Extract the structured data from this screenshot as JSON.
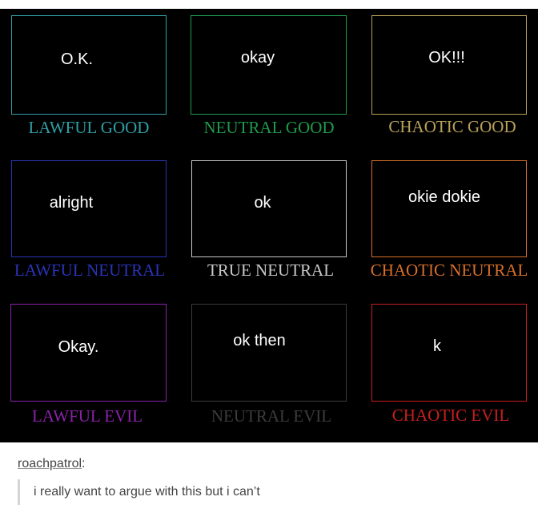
{
  "alignment_chart": {
    "cells": [
      {
        "word": "O.K.",
        "label": "LAWFUL GOOD",
        "color": "#2e9ea6"
      },
      {
        "word": "okay",
        "label": "NEUTRAL GOOD",
        "color": "#1f9a4a"
      },
      {
        "word": "OK!!!",
        "label": "CHAOTIC GOOD",
        "color": "#b9a159"
      },
      {
        "word": "alright",
        "label": "LAWFUL NEUTRAL",
        "color": "#2a34b8"
      },
      {
        "word": "ok",
        "label": "TRUE NEUTRAL",
        "color": "#c9c9c9"
      },
      {
        "word": "okie dokie",
        "label": "CHAOTIC NEUTRAL",
        "color": "#d9702b"
      },
      {
        "word": "Okay.",
        "label": "LAWFUL EVIL",
        "color": "#8a22a8"
      },
      {
        "word": "ok then",
        "label": "NEUTRAL EVIL",
        "color": "#3c3c3c"
      },
      {
        "word": "k",
        "label": "CHAOTIC EVIL",
        "color": "#c81e1e"
      }
    ]
  },
  "post": {
    "username": "roachpatrol",
    "username_suffix": ":",
    "comment": "i really want to argue with this but i can’t",
    "quote_bar_color": "#d5d5d5"
  }
}
